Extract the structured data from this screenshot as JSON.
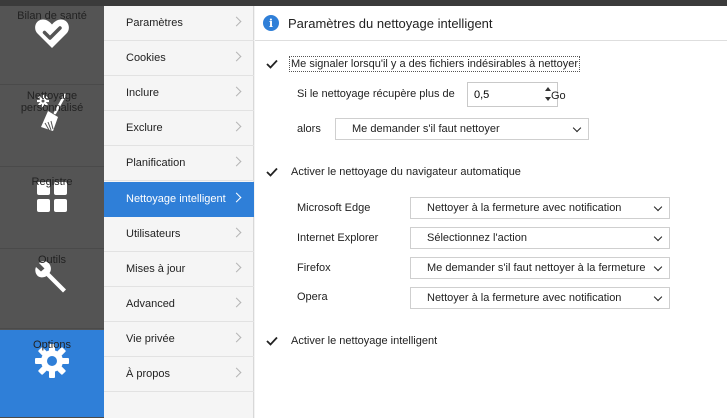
{
  "main_nav": [
    {
      "label": "Bilan de santé",
      "icon": "heart-check-icon",
      "active": false
    },
    {
      "label": "Nettoyage personnalisé",
      "icon": "broom-gear-icon",
      "active": false
    },
    {
      "label": "Registre",
      "icon": "grid-icon",
      "active": false
    },
    {
      "label": "Outils",
      "icon": "wrench-icon",
      "active": false
    },
    {
      "label": "Options",
      "icon": "gear-icon",
      "active": true
    }
  ],
  "sub_nav": [
    {
      "label": "Paramètres"
    },
    {
      "label": "Cookies"
    },
    {
      "label": "Inclure"
    },
    {
      "label": "Exclure"
    },
    {
      "label": "Planification"
    },
    {
      "label": "Nettoyage intelligent",
      "active": true
    },
    {
      "label": "Utilisateurs"
    },
    {
      "label": "Mises à jour"
    },
    {
      "label": "Advanced"
    },
    {
      "label": "Vie privée"
    },
    {
      "label": "À propos"
    }
  ],
  "header": {
    "title": "Paramètres du nettoyage intelligent",
    "icon": "info-icon"
  },
  "settings": {
    "notify_junk": {
      "label": "Me signaler lorsqu'il y a des fichiers indésirables à nettoyer",
      "checked": true
    },
    "threshold": {
      "prefix": "Si le nettoyage récupère plus de",
      "value": "0,5",
      "unit": "Go"
    },
    "then": {
      "label": "alors",
      "value": "Me demander s'il faut nettoyer"
    },
    "auto_browser": {
      "label": "Activer le nettoyage du navigateur automatique",
      "checked": true
    },
    "browsers": [
      {
        "name": "Microsoft Edge",
        "action": "Nettoyer à la fermeture avec notification"
      },
      {
        "name": "Internet Explorer",
        "action": "Sélectionnez l'action"
      },
      {
        "name": "Firefox",
        "action": "Me demander s'il faut nettoyer à la fermeture"
      },
      {
        "name": "Opera",
        "action": "Nettoyer à la fermeture avec notification"
      }
    ],
    "smart_cleaning": {
      "label": "Activer le nettoyage intelligent",
      "checked": true
    }
  },
  "colors": {
    "accent": "#2f7fd8",
    "nav_bg": "#545454"
  }
}
